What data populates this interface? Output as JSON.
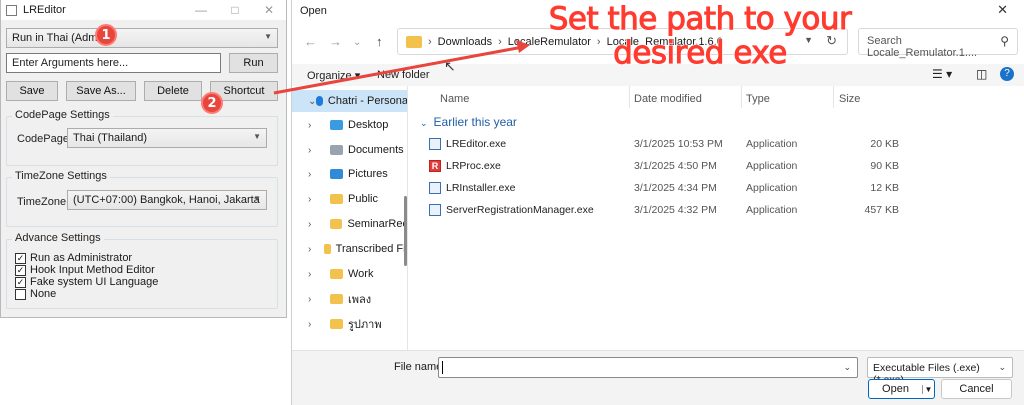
{
  "lreditor": {
    "title": "LREditor",
    "profile_selected": "Run in Thai (Admin)",
    "arguments_value": "Enter Arguments here...",
    "run_label": "Run",
    "buttons": {
      "save": "Save",
      "save_as": "Save As...",
      "delete": "Delete",
      "shortcut": "Shortcut"
    },
    "codepage_group": "CodePage Settings",
    "codepage_label": "CodePage",
    "codepage_value": "Thai (Thailand)",
    "timezone_group": "TimeZone Settings",
    "timezone_label": "TimeZone",
    "timezone_value": "(UTC+07:00) Bangkok, Hanoi, Jakarta",
    "advance_group": "Advance Settings",
    "options": [
      {
        "label": "Run as Administrator",
        "checked": true
      },
      {
        "label": "Hook Input Method Editor",
        "checked": true
      },
      {
        "label": "Fake system UI Language",
        "checked": true
      },
      {
        "label": "None",
        "checked": false
      }
    ]
  },
  "annotations": {
    "step1": "1",
    "step2": "2",
    "callout": "Set the path to your desired exe",
    "color": "#e8453c"
  },
  "dialog": {
    "title": "Open",
    "breadcrumb": [
      "Downloads",
      "LocaleRemulator",
      "Locale_Remulator.1.6.0"
    ],
    "search_placeholder": "Search Locale_Remulator.1....",
    "organize_label": "Organize",
    "new_folder_label": "New folder",
    "nav": [
      "Chatri - Persona",
      "Desktop",
      "Documents",
      "Pictures",
      "Public",
      "SeminarRec",
      "Transcribed Fil",
      "Work",
      "เพลง",
      "รูปภาพ"
    ],
    "columns": {
      "name": "Name",
      "date": "Date modified",
      "type": "Type",
      "size": "Size"
    },
    "group_header": "Earlier this year",
    "files": [
      {
        "name": "LREditor.exe",
        "date": "3/1/2025 10:53 PM",
        "type": "Application",
        "size": "20 KB"
      },
      {
        "name": "LRProc.exe",
        "date": "3/1/2025 4:50 PM",
        "type": "Application",
        "size": "90 KB"
      },
      {
        "name": "LRInstaller.exe",
        "date": "3/1/2025 4:34 PM",
        "type": "Application",
        "size": "12 KB"
      },
      {
        "name": "ServerRegistrationManager.exe",
        "date": "3/1/2025 4:32 PM",
        "type": "Application",
        "size": "457 KB"
      }
    ],
    "file_name_label": "File name:",
    "file_name_value": "",
    "filter_value": "Executable Files (.exe) (*.exe)",
    "open_label": "Open",
    "cancel_label": "Cancel"
  }
}
